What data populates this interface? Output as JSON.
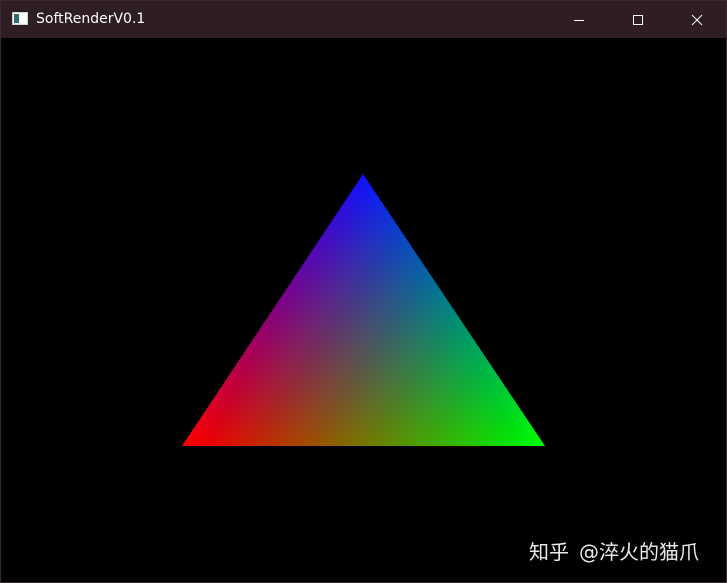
{
  "window": {
    "title": "SoftRenderV0.1",
    "icon": "app-window-icon",
    "controls": {
      "minimize_icon": "minimize-icon",
      "maximize_icon": "maximize-icon",
      "close_icon": "close-icon"
    }
  },
  "render": {
    "background_color": "#000000",
    "triangle": {
      "vertex_colors": {
        "top": "#0000ff",
        "bottom_left": "#ff0000",
        "bottom_right": "#00ff00"
      }
    }
  },
  "watermark": {
    "site": "知乎",
    "author": "@淬火的猫爪"
  },
  "colors": {
    "titlebar_bg": "#2e1d22",
    "title_text": "#ffffff",
    "window_border": "#3a2a2e"
  }
}
